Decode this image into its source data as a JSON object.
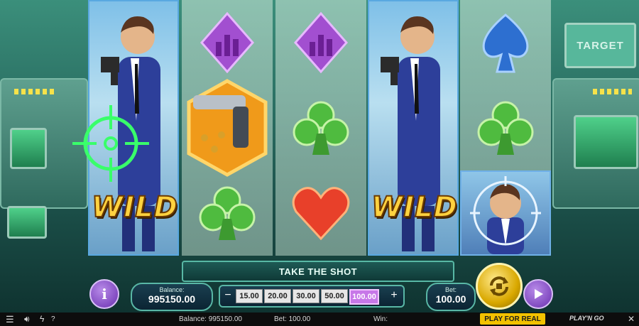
{
  "scene": {
    "target_screen_label": "TARGET",
    "colors": {
      "accent_purple": "#6a2fb0",
      "spin_gold": "#d9a800",
      "bar_teal": "#58b8a5",
      "play_real": "#f2c200"
    }
  },
  "reels": [
    {
      "type": "wild",
      "symbols": [
        "agent",
        "agent",
        "wild"
      ],
      "wild_label": "WILD",
      "overlay": "crosshair-icon"
    },
    {
      "type": "normal",
      "symbols": [
        "purple-diamond",
        "golden-pistol",
        "green-club"
      ]
    },
    {
      "type": "normal",
      "symbols": [
        "purple-diamond",
        "green-club",
        "red-heart"
      ]
    },
    {
      "type": "wild",
      "symbols": [
        "agent",
        "agent",
        "wild"
      ],
      "wild_label": "WILD"
    },
    {
      "type": "normal",
      "symbols": [
        "blue-spade",
        "green-club",
        "agent-portrait-targeted"
      ]
    }
  ],
  "message_bar": "TAKE THE SHOT",
  "controls": {
    "balance_label": "Balance:",
    "balance_value": "995150.00",
    "bet_label": "Bet:",
    "bet_value": "100.00",
    "bet_options": [
      "15.00",
      "20.00",
      "30.00",
      "50.00",
      "100.00"
    ],
    "selected_bet": "100.00",
    "minus": "−",
    "plus": "+",
    "info_glyph": "i"
  },
  "status_bar": {
    "balance_text": "Balance: 995150.00",
    "bet_text": "Bet: 100.00",
    "win_text": "Win:",
    "play_for_real": "PLAY FOR REAL",
    "brand": "PLAY'N GO",
    "help": "?"
  }
}
